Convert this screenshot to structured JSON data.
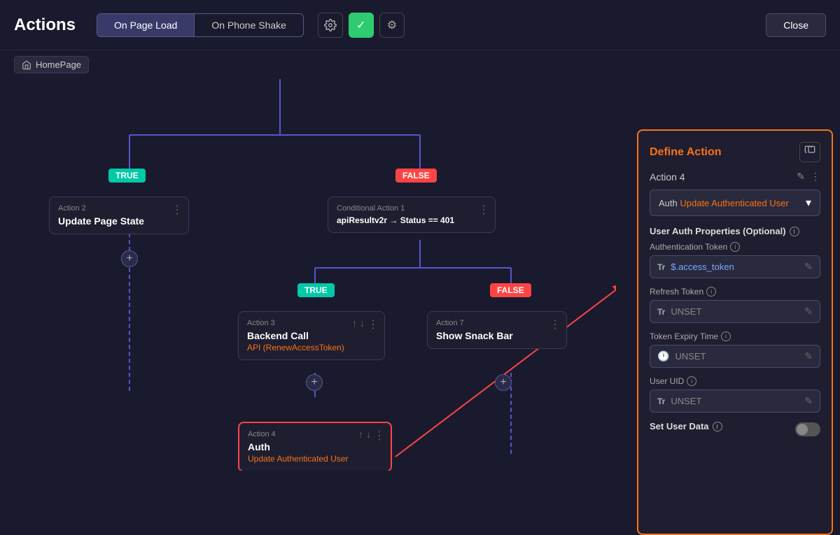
{
  "header": {
    "title": "Actions",
    "tabs": [
      {
        "label": "On Page Load",
        "active": true
      },
      {
        "label": "On Phone Shake",
        "active": false
      }
    ],
    "close_label": "Close",
    "breadcrumb": "HomePage"
  },
  "canvas": {
    "nodes": [
      {
        "id": "action2",
        "label": "Action 2",
        "title": "Update Page State",
        "subtitle": "",
        "type": "action"
      },
      {
        "id": "conditional1",
        "label": "Conditional Action 1",
        "title": "apiResultv2r → Status == 401",
        "subtitle": "",
        "type": "conditional"
      },
      {
        "id": "action3",
        "label": "Action 3",
        "title": "Backend Call",
        "subtitle": "API (RenewAccessToken)",
        "type": "action"
      },
      {
        "id": "action7",
        "label": "Action 7",
        "title": "Show Snack Bar",
        "subtitle": "",
        "type": "action"
      },
      {
        "id": "action4",
        "label": "Action 4",
        "title": "Auth",
        "subtitle": "Update Authenticated User",
        "type": "action",
        "highlighted": true
      }
    ],
    "badges": {
      "true1": "TRUE",
      "false1": "FALSE",
      "true2": "TRUE",
      "false2": "FALSE"
    }
  },
  "panel": {
    "title": "Define Action",
    "action_name": "Action 4",
    "action_selector": {
      "prefix": "Auth",
      "label": "Update Authenticated User"
    },
    "section_title": "User Auth Properties (Optional)",
    "fields": [
      {
        "label": "Authentication Token",
        "value": "$.access_token",
        "type": "token",
        "icon": "Tr"
      },
      {
        "label": "Refresh Token",
        "value": "UNSET",
        "type": "unset",
        "icon": "Tr"
      },
      {
        "label": "Token Expiry Time",
        "value": "UNSET",
        "type": "unset",
        "icon": "clock"
      },
      {
        "label": "User UID",
        "value": "UNSET",
        "type": "unset",
        "icon": "Tr"
      }
    ],
    "set_user_data": "Set User Data"
  }
}
